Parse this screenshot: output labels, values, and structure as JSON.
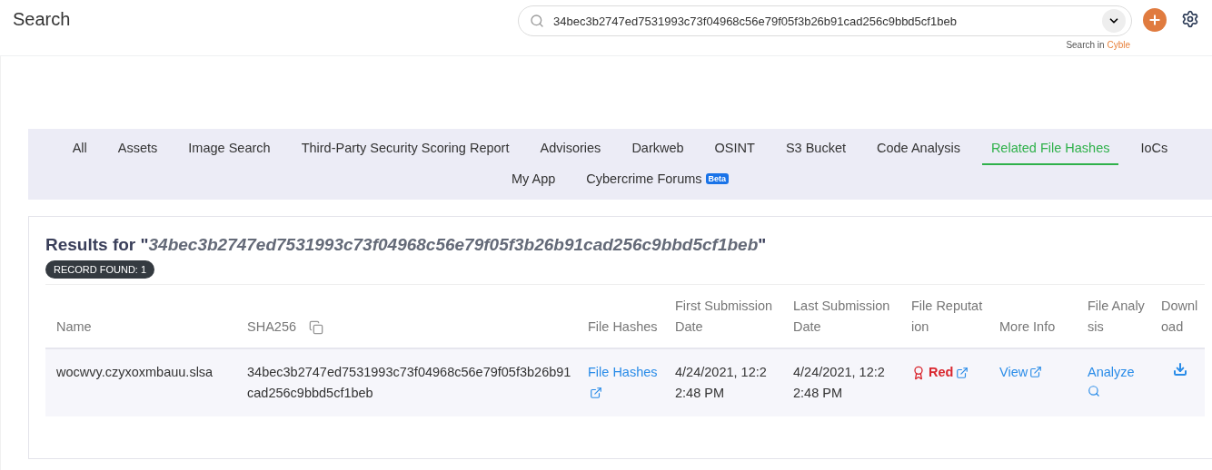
{
  "header": {
    "title": "Search",
    "search_value": "34bec3b2747ed7531993c73f04968c56e79f05f3b26b91cad256c9bbd5cf1beb",
    "search_in": "Search in",
    "search_brand": "Cyble"
  },
  "tabs": [
    {
      "label": "All",
      "selected": false
    },
    {
      "label": "Assets",
      "selected": false
    },
    {
      "label": "Image Search",
      "selected": false
    },
    {
      "label": "Third-Party Security Scoring Report",
      "selected": false
    },
    {
      "label": "Advisories",
      "selected": false
    },
    {
      "label": "Darkweb",
      "selected": false
    },
    {
      "label": "OSINT",
      "selected": false
    },
    {
      "label": "S3 Bucket",
      "selected": false
    },
    {
      "label": "Code Analysis",
      "selected": false
    },
    {
      "label": "Related File Hashes",
      "selected": true
    },
    {
      "label": "IoCs",
      "selected": false
    },
    {
      "label": "My App",
      "selected": false
    },
    {
      "label": "Cybercrime Forums",
      "selected": false,
      "badge": "Beta"
    }
  ],
  "results": {
    "prefix": "Results for \"",
    "query": "34bec3b2747ed7531993c73f04968c56e79f05f3b26b91cad256c9bbd5cf1beb",
    "suffix": "\"",
    "record_badge": "RECORD FOUND: 1"
  },
  "table": {
    "columns": [
      {
        "label": "Name"
      },
      {
        "label": "SHA256",
        "copy": true
      },
      {
        "label": "File Hashes"
      },
      {
        "label": "First Submission Date"
      },
      {
        "label": "Last Submission Date"
      },
      {
        "label": "File Reputation"
      },
      {
        "label": "More Info"
      },
      {
        "label": "File Analysis"
      },
      {
        "label": "Download"
      }
    ],
    "rows": [
      {
        "cells": [
          {
            "kind": "text",
            "text": "wocwvy.czyxoxmbauu.slsa"
          },
          {
            "kind": "text",
            "text": "34bec3b2747ed7531993c73f04968c56e79f05f3b26b91cad256c9bbd5cf1beb"
          },
          {
            "kind": "link",
            "text": "File Hashes"
          },
          {
            "kind": "text",
            "text": "4/24/2021, 12:22:48 PM"
          },
          {
            "kind": "text",
            "text": "4/24/2021, 12:22:48 PM"
          },
          {
            "kind": "reputation",
            "text": "Red",
            "color": "#d9262e"
          },
          {
            "kind": "link",
            "text": "View"
          },
          {
            "kind": "analyze",
            "text": "Analyze"
          },
          {
            "kind": "download"
          }
        ]
      }
    ]
  }
}
